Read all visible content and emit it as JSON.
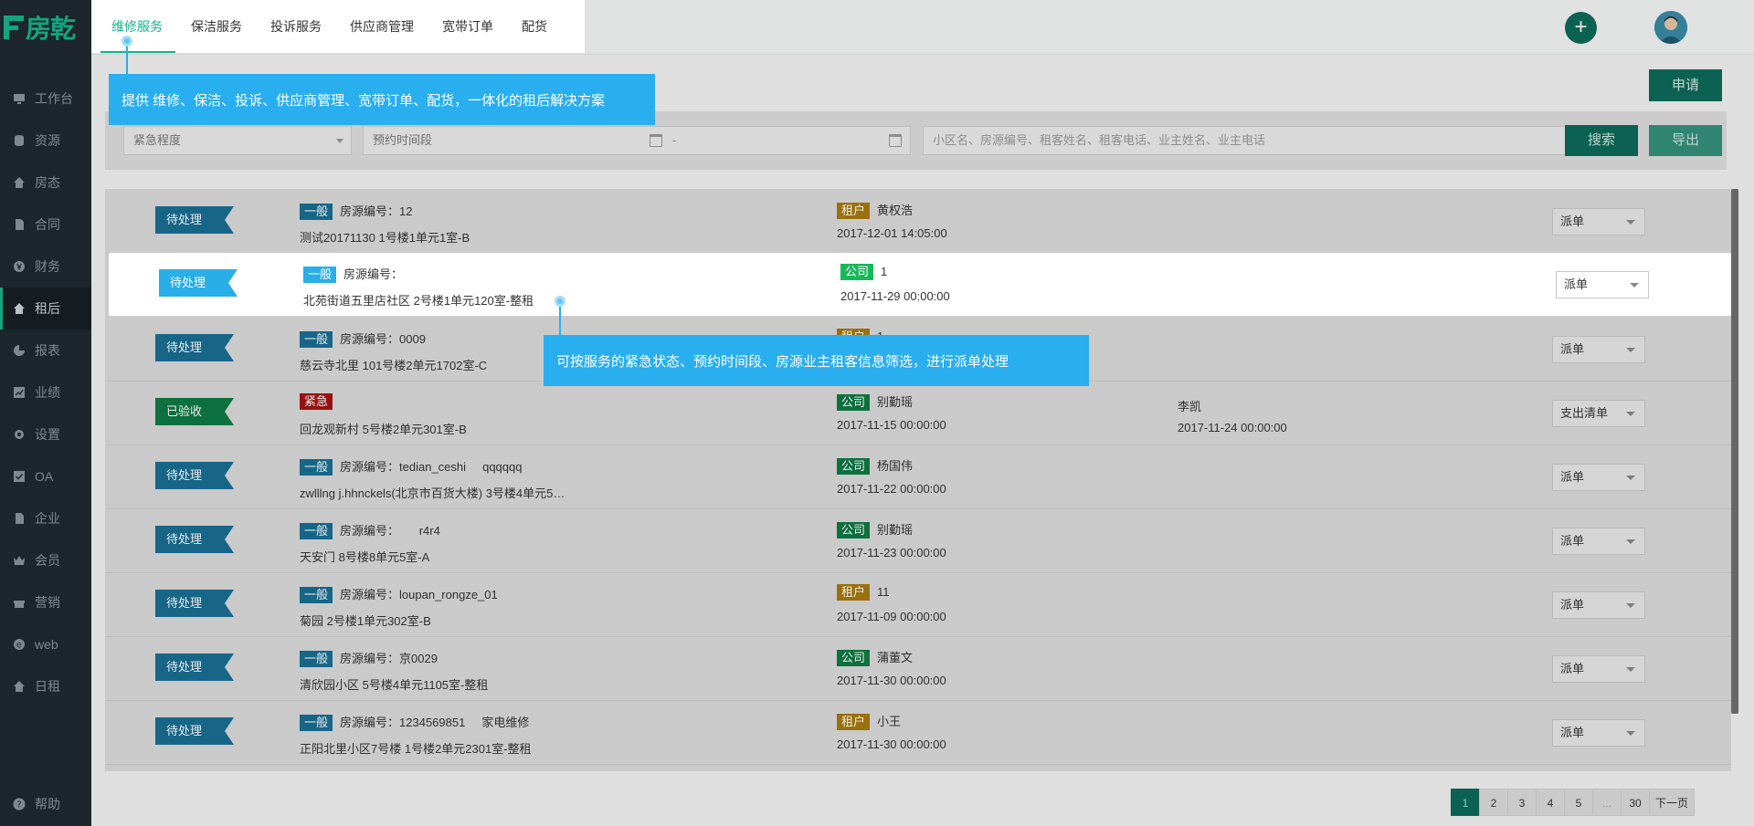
{
  "brand": {
    "logo_text": "房乾"
  },
  "sidebar": {
    "items": [
      {
        "label": "工作台",
        "icon": "monitor-icon"
      },
      {
        "label": "资源",
        "icon": "database-icon"
      },
      {
        "label": "房态",
        "icon": "house-icon"
      },
      {
        "label": "合同",
        "icon": "document-icon"
      },
      {
        "label": "财务",
        "icon": "yen-icon"
      },
      {
        "label": "租后",
        "icon": "house-icon"
      },
      {
        "label": "报表",
        "icon": "pie-chart-icon"
      },
      {
        "label": "业绩",
        "icon": "chart-icon"
      },
      {
        "label": "设置",
        "icon": "gear-icon"
      },
      {
        "label": "OA",
        "icon": "check-box-icon"
      },
      {
        "label": "企业",
        "icon": "document-icon"
      },
      {
        "label": "会员",
        "icon": "crown-icon"
      },
      {
        "label": "营销",
        "icon": "gift-icon"
      },
      {
        "label": "web",
        "icon": "e-icon"
      },
      {
        "label": "日租",
        "icon": "house-icon"
      }
    ],
    "help_label": "帮助"
  },
  "header": {
    "tabs": [
      "维修服务",
      "保洁服务",
      "投诉服务",
      "供应商管理",
      "宽带订单",
      "配货"
    ],
    "add_icon": "plus-icon"
  },
  "actions": {
    "apply": "申请",
    "search": "搜索",
    "export": "导出"
  },
  "filters": {
    "urgency_placeholder": "紧急程度",
    "period_placeholder": "预约时间段",
    "period_separator": "-",
    "keyword_placeholder": "小区名、房源编号、租客姓名、租客电话、业主姓名、业主电话"
  },
  "labels": {
    "house_no": "房源编号："
  },
  "rows": [
    {
      "status": "待处理",
      "status_type": "pending",
      "level": "一般",
      "level_type": "normal",
      "house_no": "12",
      "address": "测试20171130 1号楼1单元1室-B",
      "party_tag": "租户",
      "party_type": "tenant",
      "party_name": "黄权浩",
      "time": "2017-12-01 14:05:00",
      "handler": "",
      "handler_time": "",
      "action": "派单"
    },
    {
      "status": "待处理",
      "status_type": "pending",
      "level": "一般",
      "level_type": "normal",
      "house_no": "",
      "address": "北苑街道五里店社区 2号楼1单元120室-整租",
      "party_tag": "公司",
      "party_type": "company",
      "party_name": "1",
      "time": "2017-11-29 00:00:00",
      "handler": "",
      "handler_time": "",
      "action": "派单"
    },
    {
      "status": "待处理",
      "status_type": "pending",
      "level": "一般",
      "level_type": "normal",
      "house_no": "0009",
      "address": "慈云寺北里 101号楼2单元1702室-C",
      "party_tag": "租户",
      "party_type": "tenant",
      "party_name": "1",
      "time": "",
      "handler": "",
      "handler_time": "",
      "action": "派单"
    },
    {
      "status": "已验收",
      "status_type": "done",
      "level": "紧急",
      "level_type": "urgent",
      "house_no": null,
      "address": "回龙观新村 5号楼2单元301室-B",
      "party_tag": "公司",
      "party_type": "company",
      "party_name": "别勤瑶",
      "time": "2017-11-15 00:00:00",
      "handler": "李凯",
      "handler_time": "2017-11-24 00:00:00",
      "action": "支出清单"
    },
    {
      "status": "待处理",
      "status_type": "pending",
      "level": "一般",
      "level_type": "normal",
      "house_no": "tedian_ceshi     qqqqqq",
      "address": "zwlllng j.hhnckels(北京市百货大楼) 3号楼4单元5…",
      "party_tag": "公司",
      "party_type": "company",
      "party_name": "杨国伟",
      "time": "2017-11-22 00:00:00",
      "handler": "",
      "handler_time": "",
      "action": "派单"
    },
    {
      "status": "待处理",
      "status_type": "pending",
      "level": "一般",
      "level_type": "normal",
      "house_no": "      r4r4",
      "address": "天安门 8号楼8单元5室-A",
      "party_tag": "公司",
      "party_type": "company",
      "party_name": "别勤瑶",
      "time": "2017-11-23 00:00:00",
      "handler": "",
      "handler_time": "",
      "action": "派单"
    },
    {
      "status": "待处理",
      "status_type": "pending",
      "level": "一般",
      "level_type": "normal",
      "house_no": "loupan_rongze_01",
      "address": "菊园 2号楼1单元302室-B",
      "party_tag": "租户",
      "party_type": "tenant",
      "party_name": "11",
      "time": "2017-11-09 00:00:00",
      "handler": "",
      "handler_time": "",
      "action": "派单"
    },
    {
      "status": "待处理",
      "status_type": "pending",
      "level": "一般",
      "level_type": "normal",
      "house_no": "京0029",
      "address": "清欣园小区 5号楼4单元1105室-整租",
      "party_tag": "公司",
      "party_type": "company",
      "party_name": "蒲董文",
      "time": "2017-11-30 00:00:00",
      "handler": "",
      "handler_time": "",
      "action": "派单"
    },
    {
      "status": "待处理",
      "status_type": "pending",
      "level": "一般",
      "level_type": "normal",
      "house_no": "1234569851     家电维修",
      "address": "正阳北里小区7号楼 1号楼2单元2301室-整租",
      "party_tag": "租户",
      "party_type": "tenant",
      "party_name": "小王",
      "time": "2017-11-30 00:00:00",
      "handler": "",
      "handler_time": "",
      "action": "派单"
    }
  ],
  "pagination": {
    "pages": [
      "1",
      "2",
      "3",
      "4",
      "5",
      "...",
      "30"
    ],
    "current": "1",
    "next": "下一页"
  },
  "tooltips": {
    "tabs_tip": "提供 维修、保洁、投诉、供应商管理、宽带订单、配货，一体化的租后解决方案",
    "filter_tip": "可按服务的紧急状态、预约时间段、房源业主租客信息筛选，进行派单处理"
  },
  "colors": {
    "accent": "#14b38a",
    "dark_accent": "#0e6b5a",
    "tooltip": "#29aef0",
    "sidebar_bg": "#1f2a30"
  }
}
